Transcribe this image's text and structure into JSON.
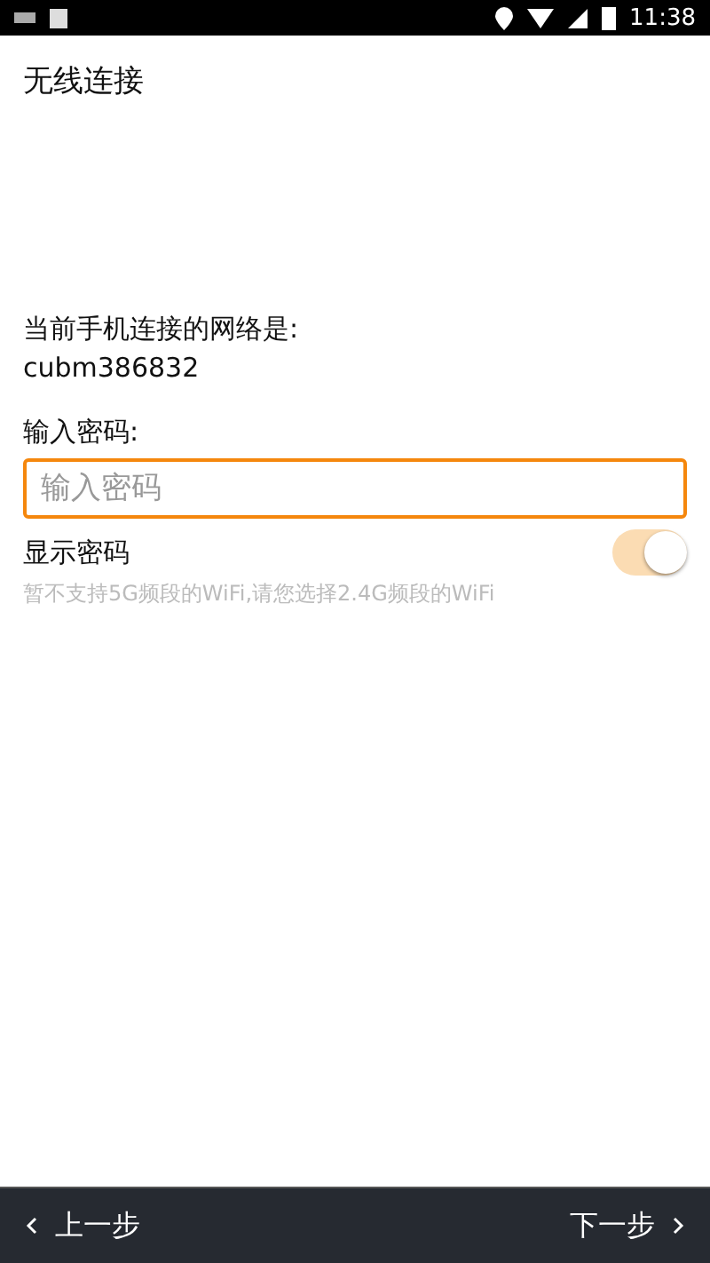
{
  "status_bar": {
    "time": "11:38"
  },
  "title": "无线连接",
  "network": {
    "label": "当前手机连接的网络是:",
    "name": "cubm386832"
  },
  "password": {
    "label": "输入密码:",
    "placeholder": "输入密码",
    "focused": true
  },
  "show_password": {
    "label": "显示密码",
    "on": true
  },
  "hint": "暂不支持5G频段的WiFi,请您选择2.4G频段的WiFi",
  "footer": {
    "back": "上一步",
    "next": "下一步"
  }
}
